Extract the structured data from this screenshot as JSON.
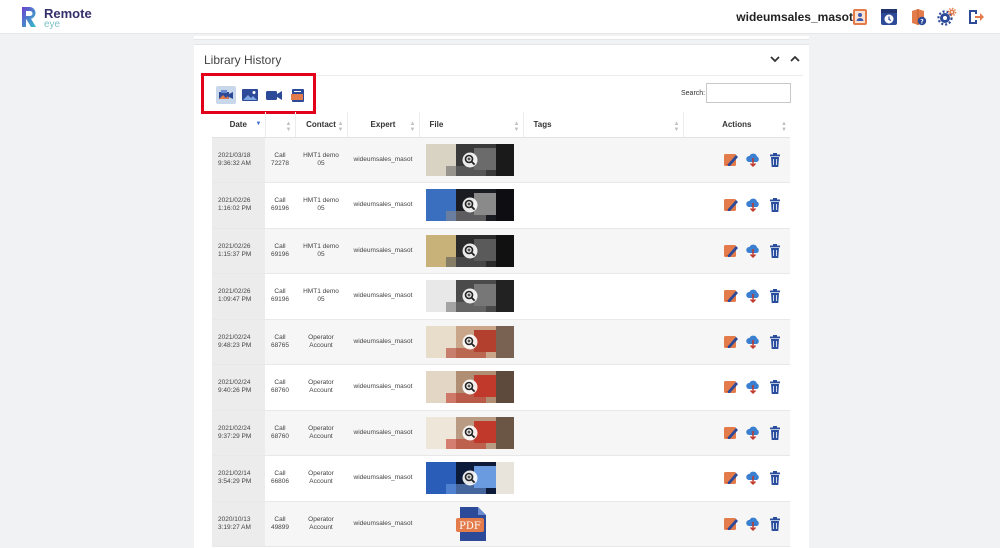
{
  "app": {
    "brand_name": "Remote",
    "brand_sub": "eye",
    "username": "wideumsales_masot",
    "top_icons": [
      "contacts-icon",
      "call-history-icon",
      "help-icon",
      "settings-icon",
      "logout-icon"
    ]
  },
  "panel": {
    "title": "Library History",
    "file_type_filters": [
      "all-media-icon",
      "image-icon",
      "video-icon",
      "document-icon"
    ],
    "active_filter": "all-media-icon",
    "search_label": "Search:",
    "search_value": ""
  },
  "table": {
    "headers": [
      "Date",
      "",
      "Contact",
      "Expert",
      "File",
      "Tags",
      "Actions"
    ],
    "sorted_column": "Date",
    "rows": [
      {
        "date": "2021/03/18",
        "time": "9:36:32 AM",
        "call_label": "Call",
        "call_id": "72278",
        "contact_1": "HMT1 demo",
        "contact_2": "05",
        "expert": "wideumsales_masot",
        "file_type": "image",
        "tags": ""
      },
      {
        "date": "2021/02/26",
        "time": "1:16:02 PM",
        "call_label": "Call",
        "call_id": "69196",
        "contact_1": "HMT1 demo",
        "contact_2": "05",
        "expert": "wideumsales_masot",
        "file_type": "image",
        "tags": ""
      },
      {
        "date": "2021/02/26",
        "time": "1:15:37 PM",
        "call_label": "Call",
        "call_id": "69196",
        "contact_1": "HMT1 demo",
        "contact_2": "05",
        "expert": "wideumsales_masot",
        "file_type": "image",
        "tags": ""
      },
      {
        "date": "2021/02/26",
        "time": "1:09:47 PM",
        "call_label": "Call",
        "call_id": "69196",
        "contact_1": "HMT1 demo",
        "contact_2": "05",
        "expert": "wideumsales_masot",
        "file_type": "image",
        "tags": ""
      },
      {
        "date": "2021/02/24",
        "time": "9:48:23 PM",
        "call_label": "Call",
        "call_id": "68765",
        "contact_1": "Operator",
        "contact_2": "Account",
        "expert": "wideumsales_masot",
        "file_type": "image",
        "tags": ""
      },
      {
        "date": "2021/02/24",
        "time": "9:40:26 PM",
        "call_label": "Call",
        "call_id": "68760",
        "contact_1": "Operator",
        "contact_2": "Account",
        "expert": "wideumsales_masot",
        "file_type": "image",
        "tags": ""
      },
      {
        "date": "2021/02/24",
        "time": "9:37:29 PM",
        "call_label": "Call",
        "call_id": "68760",
        "contact_1": "Operator",
        "contact_2": "Account",
        "expert": "wideumsales_masot",
        "file_type": "image",
        "tags": ""
      },
      {
        "date": "2021/02/14",
        "time": "3:54:29 PM",
        "call_label": "Call",
        "call_id": "66806",
        "contact_1": "Operator",
        "contact_2": "Account",
        "expert": "wideumsales_masot",
        "file_type": "image",
        "tags": ""
      },
      {
        "date": "2020/10/13",
        "time": "3:19:27 AM",
        "call_label": "Call",
        "call_id": "49899",
        "contact_1": "Operator",
        "contact_2": "Account",
        "expert": "wideumsales_masot",
        "file_type": "pdf",
        "file_label": "PDF",
        "tags": ""
      }
    ],
    "row_actions": [
      "annotate-icon",
      "download-icon",
      "delete-icon"
    ]
  },
  "colors": {
    "brand": "#35306b",
    "accent": "#3a6bd0",
    "highlight": "#e2001a",
    "delete": "#2a4d9e"
  }
}
